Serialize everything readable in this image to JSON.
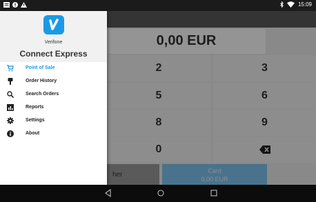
{
  "statusbar": {
    "time": "15:09"
  },
  "app": {
    "amount": "0,00 EUR",
    "keys": [
      "2",
      "3",
      "5",
      "6",
      "8",
      "9",
      "0"
    ],
    "other_button": "her",
    "card_button": {
      "line1": "Card",
      "line2": "0,00 EUR"
    }
  },
  "drawer": {
    "brand": "Verifone",
    "app_name": "Connect Express",
    "menu": [
      {
        "label": "Point of Sale",
        "icon": "cart-icon",
        "active": true
      },
      {
        "label": "Order History",
        "icon": "history-icon",
        "active": false
      },
      {
        "label": "Search Orders",
        "icon": "search-icon",
        "active": false
      },
      {
        "label": "Reports",
        "icon": "chart-icon",
        "active": false
      },
      {
        "label": "Settings",
        "icon": "gear-icon",
        "active": false
      },
      {
        "label": "About",
        "icon": "info-icon",
        "active": false
      }
    ]
  },
  "colors": {
    "accent": "#1a9ae6",
    "card_button": "#7fc7f2"
  }
}
